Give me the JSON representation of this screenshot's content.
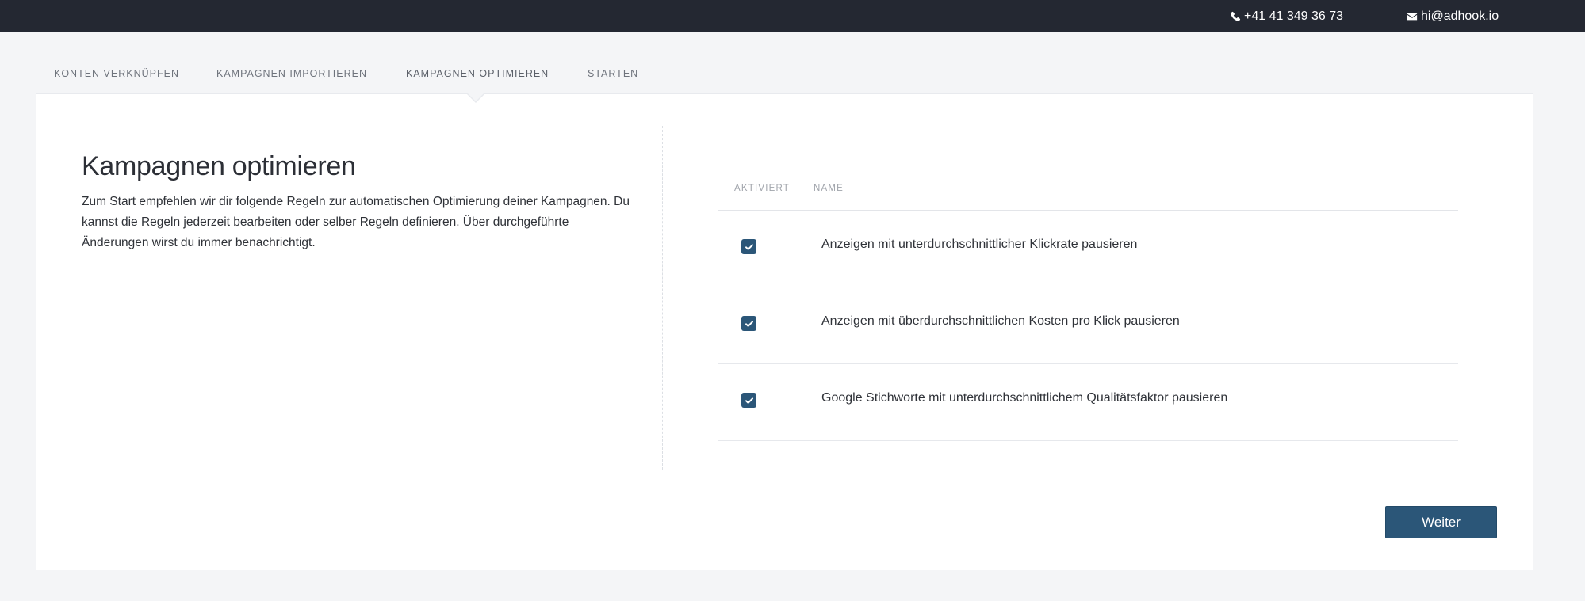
{
  "topbar": {
    "phone": "+41 41 349 36 73",
    "email": "hi@adhook.io",
    "phone_icon": "phone-icon",
    "email_icon": "envelope-icon"
  },
  "steps": [
    {
      "label": "KONTEN VERKNÜPFEN"
    },
    {
      "label": "KAMPAGNEN IMPORTIEREN"
    },
    {
      "label": "KAMPAGNEN OPTIMIEREN",
      "active": true
    },
    {
      "label": "STARTEN"
    }
  ],
  "main": {
    "title": "Kampagnen optimieren",
    "description": "Zum Start empfehlen wir dir folgende Regeln zur automatischen Optimierung deiner Kampagnen. Du kannst die Regeln jederzeit bearbeiten oder selber Regeln definieren. Über durchgeführte Änderungen wirst du immer benachrichtigt."
  },
  "rules_table": {
    "headers": {
      "activated": "AKTIVIERT",
      "name": "NAME"
    },
    "rows": [
      {
        "checked": true,
        "name": "Anzeigen mit unterdurchschnittlicher Klickrate pausieren"
      },
      {
        "checked": true,
        "name": "Anzeigen mit überdurchschnittlichen Kosten pro Klick pausieren"
      },
      {
        "checked": true,
        "name": "Google Stichworte mit unterdurchschnittlichem Qualitätsfaktor pausieren"
      }
    ]
  },
  "actions": {
    "next_label": "Weiter"
  },
  "colors": {
    "topbar": "#242832",
    "primary": "#2b5678",
    "background": "#f4f5f7"
  }
}
